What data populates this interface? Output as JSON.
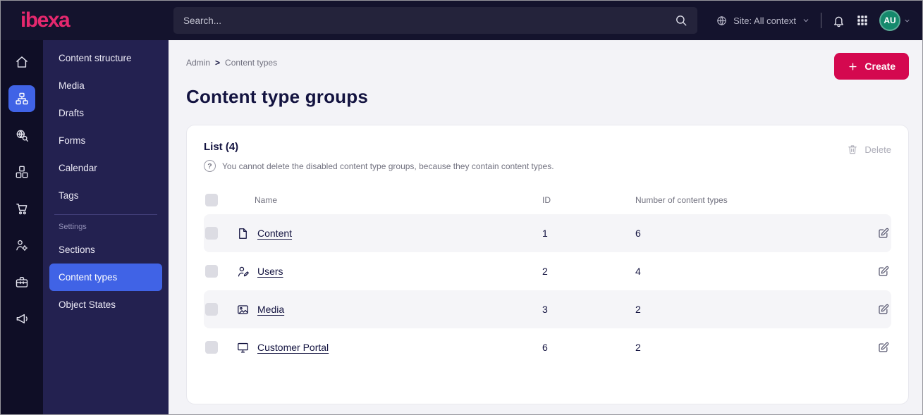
{
  "colors": {
    "brand_pink": "#DB0853",
    "active_blue": "#4063E6",
    "topbar_bg": "#14132D",
    "rail_bg": "#0F0E26",
    "menu_bg": "#232150",
    "page_bg": "#F3F3F7",
    "avatar_green": "#15896C"
  },
  "topbar": {
    "logo": "ibexa",
    "search_placeholder": "Search...",
    "site_context": "Site: All context",
    "avatar_initials": "AU"
  },
  "sidebar": {
    "items": [
      {
        "label": "Content structure"
      },
      {
        "label": "Media"
      },
      {
        "label": "Drafts"
      },
      {
        "label": "Forms"
      },
      {
        "label": "Calendar"
      },
      {
        "label": "Tags"
      }
    ],
    "settings_label": "Settings",
    "settings_items": [
      {
        "label": "Sections"
      },
      {
        "label": "Content types"
      },
      {
        "label": "Object States"
      }
    ]
  },
  "breadcrumb": {
    "items": [
      "Admin",
      "Content types"
    ],
    "separator": ">"
  },
  "page": {
    "title": "Content type groups"
  },
  "actions": {
    "create": "Create",
    "delete": "Delete"
  },
  "list": {
    "title": "List (4)",
    "note": "You cannot delete the disabled content type groups, because they contain content types."
  },
  "table": {
    "headers": [
      "Name",
      "ID",
      "Number of content types"
    ],
    "rows": [
      {
        "name": "Content",
        "id": "1",
        "count": "6",
        "icon": "content-file-icon"
      },
      {
        "name": "Users",
        "id": "2",
        "count": "4",
        "icon": "user-edit-icon"
      },
      {
        "name": "Media",
        "id": "3",
        "count": "2",
        "icon": "media-image-icon"
      },
      {
        "name": "Customer Portal",
        "id": "6",
        "count": "2",
        "icon": "portal-monitor-icon"
      }
    ]
  },
  "icons": {
    "help_glyph": "?"
  }
}
